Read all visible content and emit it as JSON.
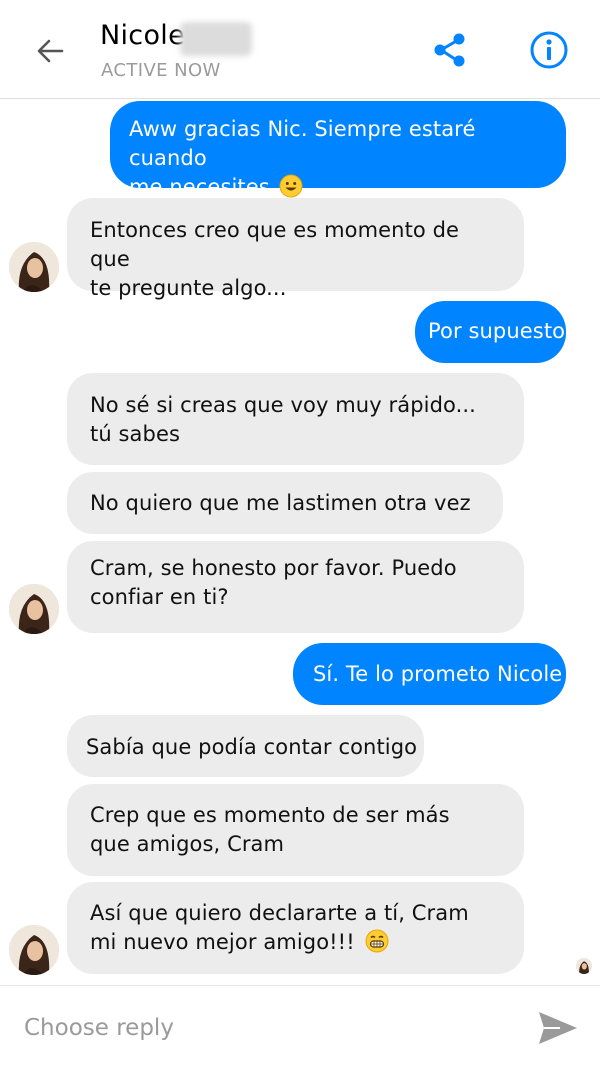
{
  "header": {
    "contact_name": "Nicole",
    "status": "ACTIVE NOW",
    "icons": [
      "back-arrow-icon",
      "share-icon",
      "info-icon"
    ],
    "accent_color": "#0084ff"
  },
  "messages": [
    {
      "direction": "outgoing",
      "lines": [
        "Aww gracias Nic. Siempre estaré cuando",
        "me necesites"
      ],
      "emoji": "smile"
    },
    {
      "direction": "incoming",
      "lines": [
        "Entonces creo que es momento de que",
        "te pregunte algo..."
      ]
    },
    {
      "direction": "outgoing",
      "lines": [
        "Por supuesto"
      ]
    },
    {
      "direction": "incoming",
      "lines": [
        "No sé si creas que voy muy rápido...",
        "tú sabes"
      ]
    },
    {
      "direction": "incoming",
      "lines": [
        "No quiero que me lastimen otra vez"
      ]
    },
    {
      "direction": "incoming",
      "lines": [
        "Cram, se honesto por favor. Puedo",
        "confiar en ti?"
      ]
    },
    {
      "direction": "outgoing",
      "lines": [
        "Sí. Te lo prometo Nicole"
      ]
    },
    {
      "direction": "incoming",
      "lines": [
        "Sabía que podía contar contigo"
      ]
    },
    {
      "direction": "incoming",
      "lines": [
        "Crep que es momento de ser más",
        "que amigos, Cram"
      ]
    },
    {
      "direction": "incoming",
      "lines": [
        "Así que quiero declararte a tí, Cram",
        "mi nuevo mejor amigo!!!"
      ],
      "emoji": "grin"
    }
  ],
  "composer": {
    "placeholder": "Choose reply",
    "send_icon": "send-icon"
  },
  "colors": {
    "outgoing_bubble": "#0084ff",
    "incoming_bubble": "#ececec"
  }
}
